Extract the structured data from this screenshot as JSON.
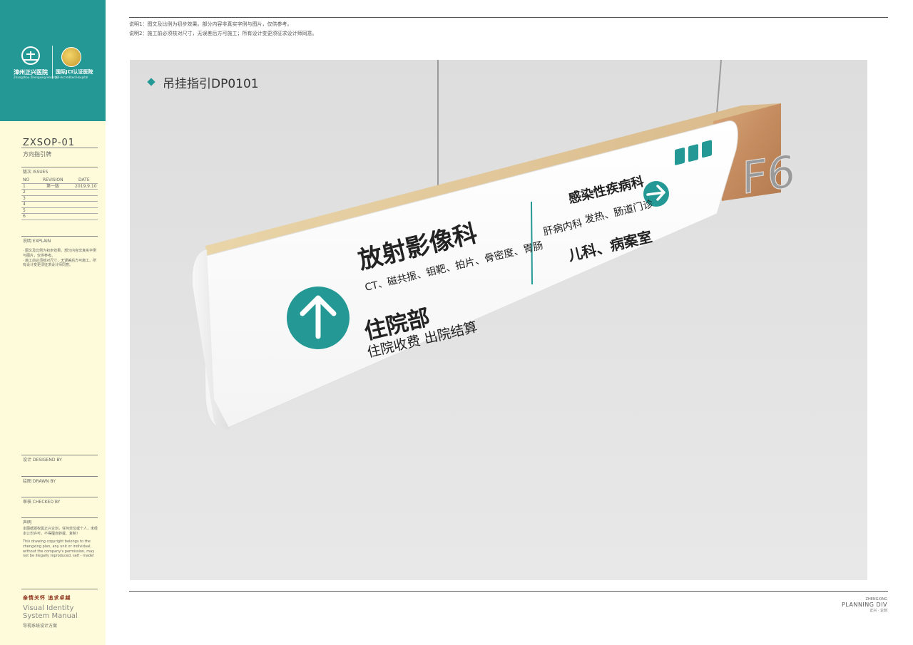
{
  "notes": [
    "说明1：图文及比例为初步效果。部分内容非真实字例与图片，仅供参考。",
    "说明2：施工前必须核对尺寸，无误差后方可施工；所有设计变更须征求设计师同意。"
  ],
  "logo": {
    "hospital_cn": "漳州正兴医院",
    "hospital_en": "Zhangzhou Zhengxing Hospital",
    "jci_cn": "国际JCI认证医院",
    "jci_en": "JCI-Accredited Hospital",
    "mark_text": "正兴"
  },
  "sheet": {
    "code": "ZXSOP-01",
    "name": "方向指引牌",
    "issues_label": "版次 ISSUES",
    "table_headers": [
      "NO",
      "REVISION",
      "DATE"
    ],
    "table_rows": [
      {
        "no": "1",
        "revision": "第一版",
        "date": "2019.9.10"
      },
      {
        "no": "2",
        "revision": "",
        "date": ""
      },
      {
        "no": "3",
        "revision": "",
        "date": ""
      },
      {
        "no": "4",
        "revision": "",
        "date": ""
      },
      {
        "no": "5",
        "revision": "",
        "date": ""
      },
      {
        "no": "6",
        "revision": "",
        "date": ""
      }
    ],
    "explain_label": "说明 EXPLAIN",
    "explain_text": "· 图文及比例为初步效果。部分内容非真实字例与图片，仅供参考。\n· 施工前必须核对尺寸，无误差后方可施工。所有设计变更须征求设计师同意。",
    "designed_by": "设计 DESIGEND BY",
    "drawn_by": "绘图 DRAWN BY",
    "checked_by": "审核 CHECKED BY",
    "statement_label": "声明",
    "statement_cn": "本图纸版权属正兴企划，任何单位或个人，未经本公司许可，不得擅自转载、复制！",
    "statement_en": "This drawing copyright belongs to the zhengxing plan, any unit or individual, without the company's permission, may not be illegally reproduced, self - made!",
    "slogan": "亲情关怀  追求卓越",
    "manual_en": "Visual Identity System Manual",
    "manual_cn": "导视系统设计方案"
  },
  "view": {
    "title": "吊挂指引DP0101"
  },
  "sign": {
    "left_dept": "放射影像科",
    "left_sub": "CT、磁共振、钼靶、拍片、骨密度、胃肠",
    "left_dept2": "住院部",
    "left_sub2": "住院收费  出院结算",
    "right_dept": "感染性疾病科",
    "right_sub_a": "肝病内科",
    "right_sub_b": "发热、肠道门诊",
    "right_dept2": "儿科、病案室",
    "floor": "F6",
    "accent_color": "#239894",
    "left_arrow_icon": "arrow-up-icon",
    "right_arrow_icon": "arrow-right-icon",
    "facility_icons": [
      "escalator-icon",
      "elevator-icon",
      "restroom-icon"
    ]
  },
  "footer": {
    "company_small": "ZHENGXING",
    "company_main": "PLANNING DIV",
    "company_cn": "正兴 · 企划"
  }
}
